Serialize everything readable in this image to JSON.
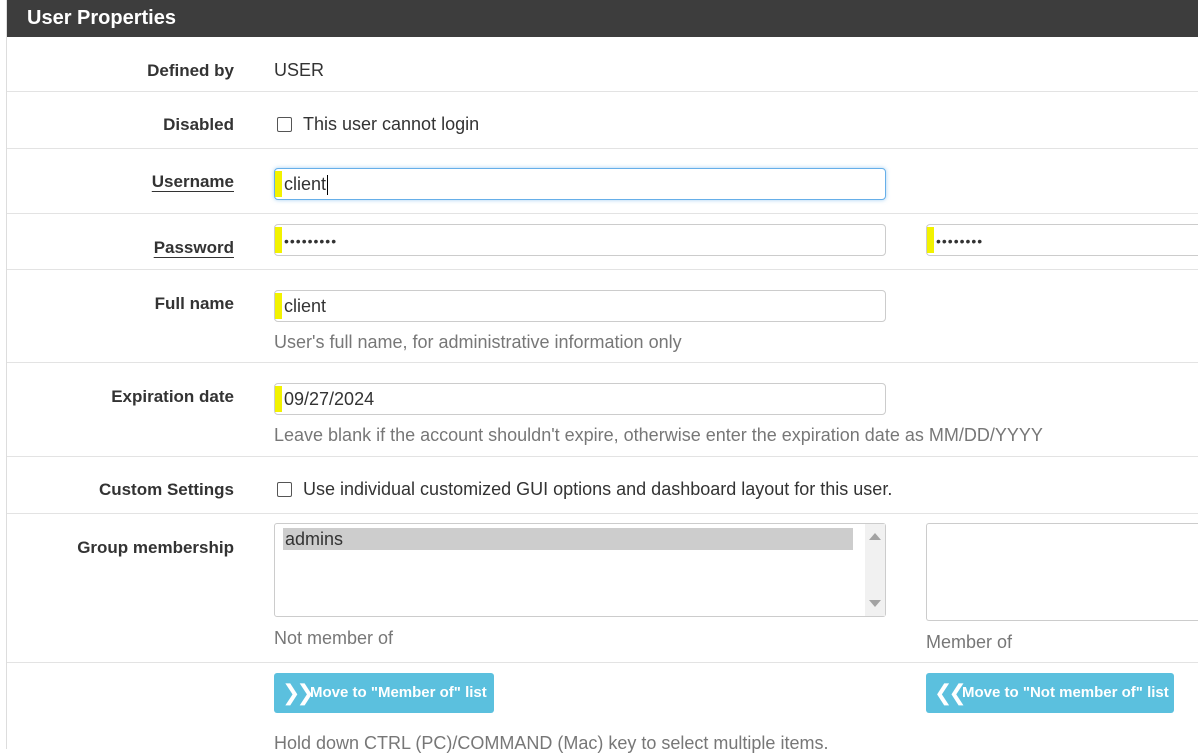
{
  "panel": {
    "title": "User Properties"
  },
  "defined_by": {
    "label": "Defined by",
    "value": "USER"
  },
  "disabled": {
    "label": "Disabled",
    "checkbox_label": "This user cannot login"
  },
  "username": {
    "label": "Username",
    "value": "client"
  },
  "password": {
    "label": "Password",
    "value": "•••••••••",
    "confirm_value": "••••••••"
  },
  "full_name": {
    "label": "Full name",
    "value": "client",
    "help": "User's full name, for administrative information only"
  },
  "expiration": {
    "label": "Expiration date",
    "value": "09/27/2024",
    "help": "Leave blank if the account shouldn't expire, otherwise enter the expiration date as MM/DD/YYYY"
  },
  "custom_settings": {
    "label": "Custom Settings",
    "checkbox_label": "Use individual customized GUI options and dashboard layout for this user."
  },
  "groups": {
    "label": "Group membership",
    "not_member_options": [
      "admins"
    ],
    "not_member_caption": "Not member of",
    "member_caption": "Member of",
    "move_to_member_label": "Move to \"Member of\" list",
    "move_to_not_member_label": "Move to \"Not member of\" list",
    "help": "Hold down CTRL (PC)/COMMAND (Mac) key to select multiple items."
  },
  "colors": {
    "header_bg": "#3d3d3d",
    "button_bg": "#5bc0de",
    "highlight": "#f2f200"
  }
}
